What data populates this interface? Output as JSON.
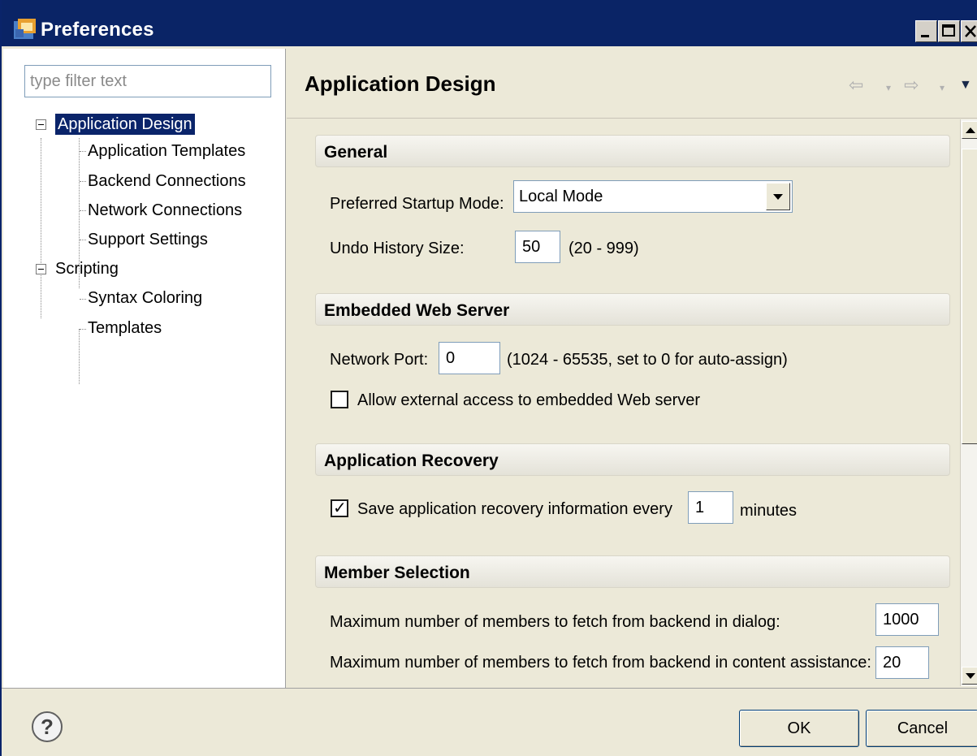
{
  "window": {
    "title": "Preferences"
  },
  "filter": {
    "placeholder": "type filter text"
  },
  "tree": [
    {
      "label": "Application Design",
      "selected": true,
      "children": [
        "Application Templates",
        "Backend Connections",
        "Network Connections",
        "Support Settings"
      ]
    },
    {
      "label": "Scripting",
      "selected": false,
      "children": [
        "Syntax Coloring",
        "Templates"
      ]
    }
  ],
  "page": {
    "title": "Application Design"
  },
  "nav_icons": {
    "back": "back-arrow-icon",
    "forward": "forward-arrow-icon",
    "menu": "view-menu-icon"
  },
  "sections": {
    "general": {
      "title": "General",
      "startup_label": "Preferred Startup Mode:",
      "startup_value": "Local Mode",
      "undo_label": "Undo History Size:",
      "undo_value": "50",
      "undo_range": "(20 - 999)"
    },
    "web_server": {
      "title": "Embedded Web Server",
      "port_label": "Network Port:",
      "port_value": "0",
      "port_hint": "(1024 - 65535, set to 0 for auto-assign)",
      "external_access_label": "Allow external access to embedded Web server",
      "external_access_checked": false
    },
    "recovery": {
      "title": "Application Recovery",
      "save_label": "Save application recovery information every",
      "save_checked": true,
      "save_value": "1",
      "save_unit": "minutes"
    },
    "member_selection": {
      "title": "Member Selection",
      "dialog_label": "Maximum number of members to fetch from backend in dialog:",
      "dialog_value": "1000",
      "assist_label": "Maximum number of members to fetch from backend in content assistance:",
      "assist_value": "20"
    }
  },
  "buttons": {
    "ok": "OK",
    "cancel": "Cancel",
    "help": "?"
  }
}
